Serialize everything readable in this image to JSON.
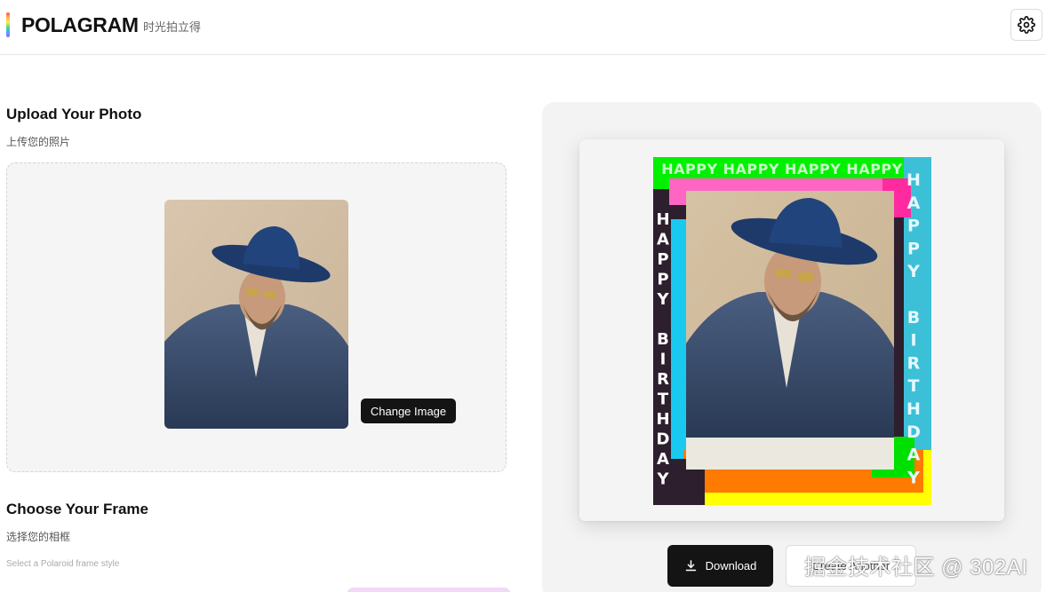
{
  "header": {
    "brand_name": "POLAGRAM",
    "brand_tagline": "时光拍立得",
    "settings_icon": "gear-icon"
  },
  "upload": {
    "title": "Upload Your Photo",
    "subtitle": "上传您的照片",
    "change_button": "Change Image"
  },
  "frame_section": {
    "title": "Choose Your Frame",
    "subtitle": "选择您的相框",
    "hint": "Select a Polaroid frame style"
  },
  "preview": {
    "frame_top_text": "HAPPY HAPPY HAPPY HAPPY",
    "frame_left_letters": [
      "H",
      "A",
      "P",
      "P",
      "Y",
      "",
      "B",
      "I",
      "R",
      "T",
      "H",
      "D",
      "A",
      "Y"
    ],
    "frame_right_letters": [
      "H",
      "A",
      "P",
      "P",
      "Y",
      "",
      "B",
      "I",
      "R",
      "T",
      "H",
      "D",
      "A",
      "Y"
    ],
    "download_button": "Download",
    "download_icon": "download-icon",
    "secondary_button": "Create Another"
  },
  "watermark": "掘金技术社区 @ 302AI"
}
